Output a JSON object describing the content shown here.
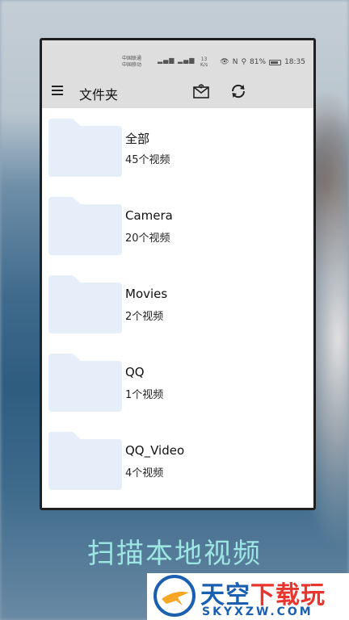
{
  "status_bar": {
    "carrier_1": "中国联通",
    "carrier_2": "中国移动",
    "network_speed_value": "13",
    "network_speed_unit": "K/s",
    "battery": "81%",
    "time": "18:35"
  },
  "app_bar": {
    "title": "文件夹",
    "menu_icon": "hamburger-menu-icon",
    "mail_icon": "mail-icon",
    "refresh_icon": "refresh-icon"
  },
  "folders": [
    {
      "name": "全部",
      "count": "45个视频"
    },
    {
      "name": "Camera",
      "count": "20个视频"
    },
    {
      "name": "Movies",
      "count": "2个视频"
    },
    {
      "name": "QQ",
      "count": "1个视频"
    },
    {
      "name": "QQ_Video",
      "count": "4个视频"
    }
  ],
  "caption": "扫描本地视频",
  "watermark": {
    "title_part1": "天空",
    "title_part2": "下载玩",
    "subtitle": "SKYXZW.COM"
  },
  "colors": {
    "folder_fill": "#e6eff9",
    "app_bar_bg": "#dedede",
    "caption": "#9ce6e3",
    "watermark_blue": "#1a5fb0",
    "watermark_red": "#e8362f"
  }
}
